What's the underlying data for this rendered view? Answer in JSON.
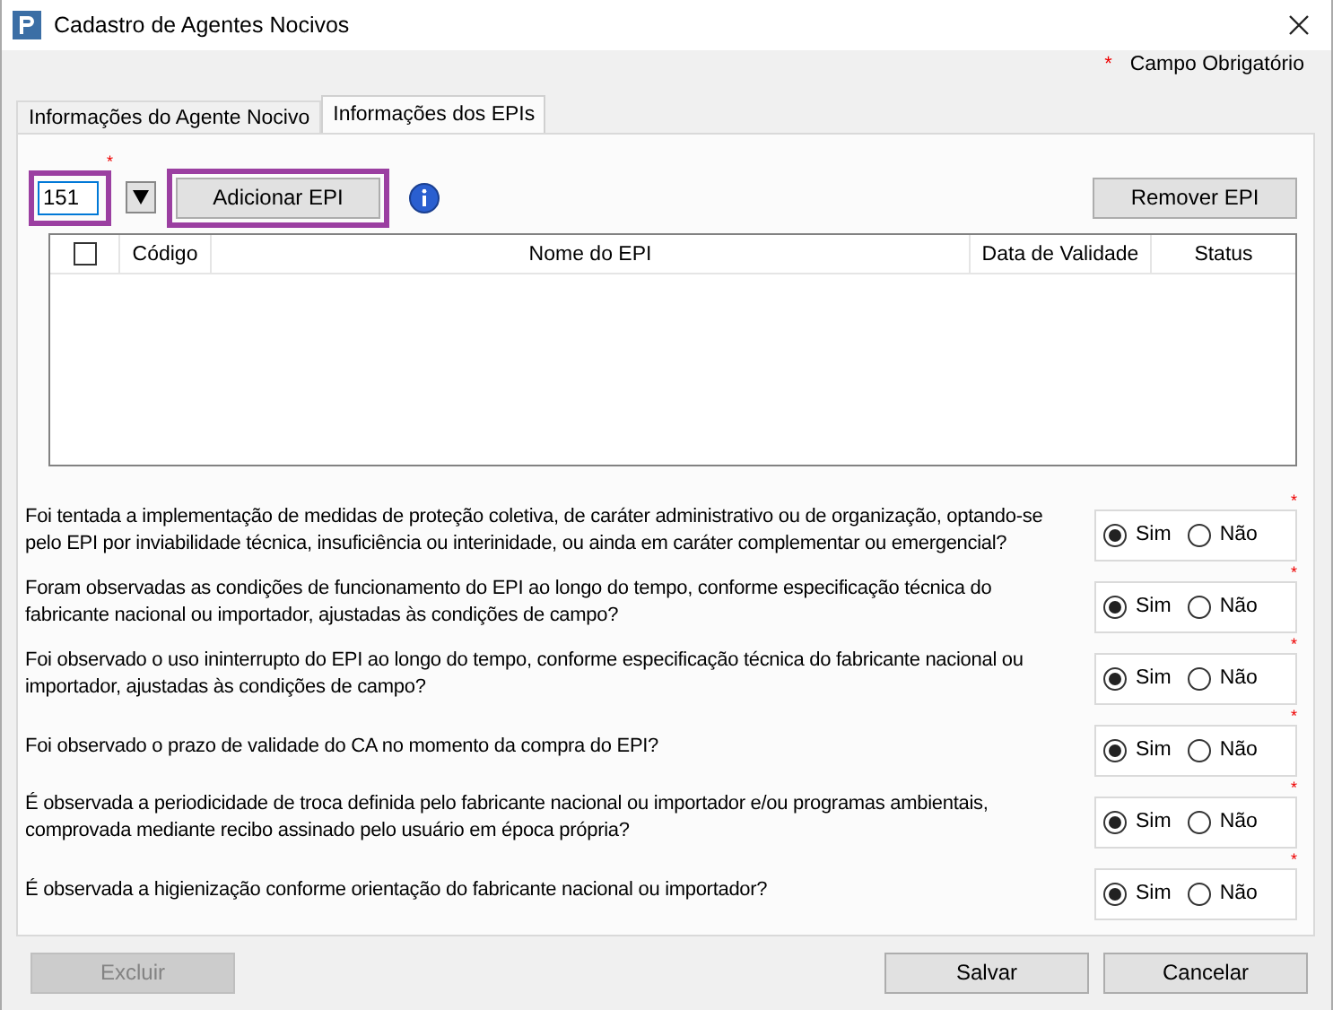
{
  "window": {
    "title": "Cadastro de Agentes Nocivos"
  },
  "required_legend": {
    "mark": "*",
    "text": "Campo Obrigatório"
  },
  "tabs": [
    {
      "label": "Informações do Agente Nocivo",
      "selected": false
    },
    {
      "label": "Informações dos EPIs",
      "selected": true
    }
  ],
  "epi_field": {
    "value": "151",
    "required_mark": "*",
    "highlighted": true
  },
  "add_button": {
    "label": "Adicionar EPI",
    "highlighted": true
  },
  "remove_button": {
    "label": "Remover EPI"
  },
  "table": {
    "select_all_checked": false,
    "columns": [
      "Código",
      "Nome do EPI",
      "Data de Validade",
      "Status"
    ]
  },
  "questions": [
    {
      "text": "Foi tentada a implementação de medidas de proteção coletiva, de caráter administrativo ou de organização, optando-se pelo EPI por inviabilidade técnica, insuficiência ou interinidade, ou ainda em caráter complementar ou emergencial?",
      "required_mark": "*",
      "options": [
        {
          "label": "Sim",
          "selected": true
        },
        {
          "label": "Não",
          "selected": false
        }
      ]
    },
    {
      "text": "Foram observadas as condições de funcionamento do EPI ao longo do tempo, conforme especificação técnica do fabricante nacional ou importador, ajustadas às condições de campo?",
      "required_mark": "*",
      "options": [
        {
          "label": "Sim",
          "selected": true
        },
        {
          "label": "Não",
          "selected": false
        }
      ]
    },
    {
      "text": "Foi observado o uso ininterrupto do EPI ao longo do tempo, conforme especificação técnica do fabricante nacional ou importador, ajustadas às condições de campo?",
      "required_mark": "*",
      "options": [
        {
          "label": "Sim",
          "selected": true
        },
        {
          "label": "Não",
          "selected": false
        }
      ]
    },
    {
      "text": "Foi observado o prazo de validade do CA no momento da compra do EPI?",
      "required_mark": "*",
      "options": [
        {
          "label": "Sim",
          "selected": true
        },
        {
          "label": "Não",
          "selected": false
        }
      ]
    },
    {
      "text": "É observada a periodicidade de troca definida pelo fabricante nacional ou importador e/ou programas ambientais, comprovada mediante recibo assinado pelo usuário em época própria?",
      "required_mark": "*",
      "options": [
        {
          "label": "Sim",
          "selected": true
        },
        {
          "label": "Não",
          "selected": false
        }
      ]
    },
    {
      "text": "É observada a higienização conforme orientação do fabricante nacional ou importador?",
      "required_mark": "*",
      "options": [
        {
          "label": "Sim",
          "selected": true
        },
        {
          "label": "Não",
          "selected": false
        }
      ]
    }
  ],
  "footer_buttons": [
    {
      "label": "Excluir",
      "disabled": true
    },
    {
      "label": "Salvar",
      "disabled": false
    },
    {
      "label": "Cancelar",
      "disabled": false
    }
  ]
}
